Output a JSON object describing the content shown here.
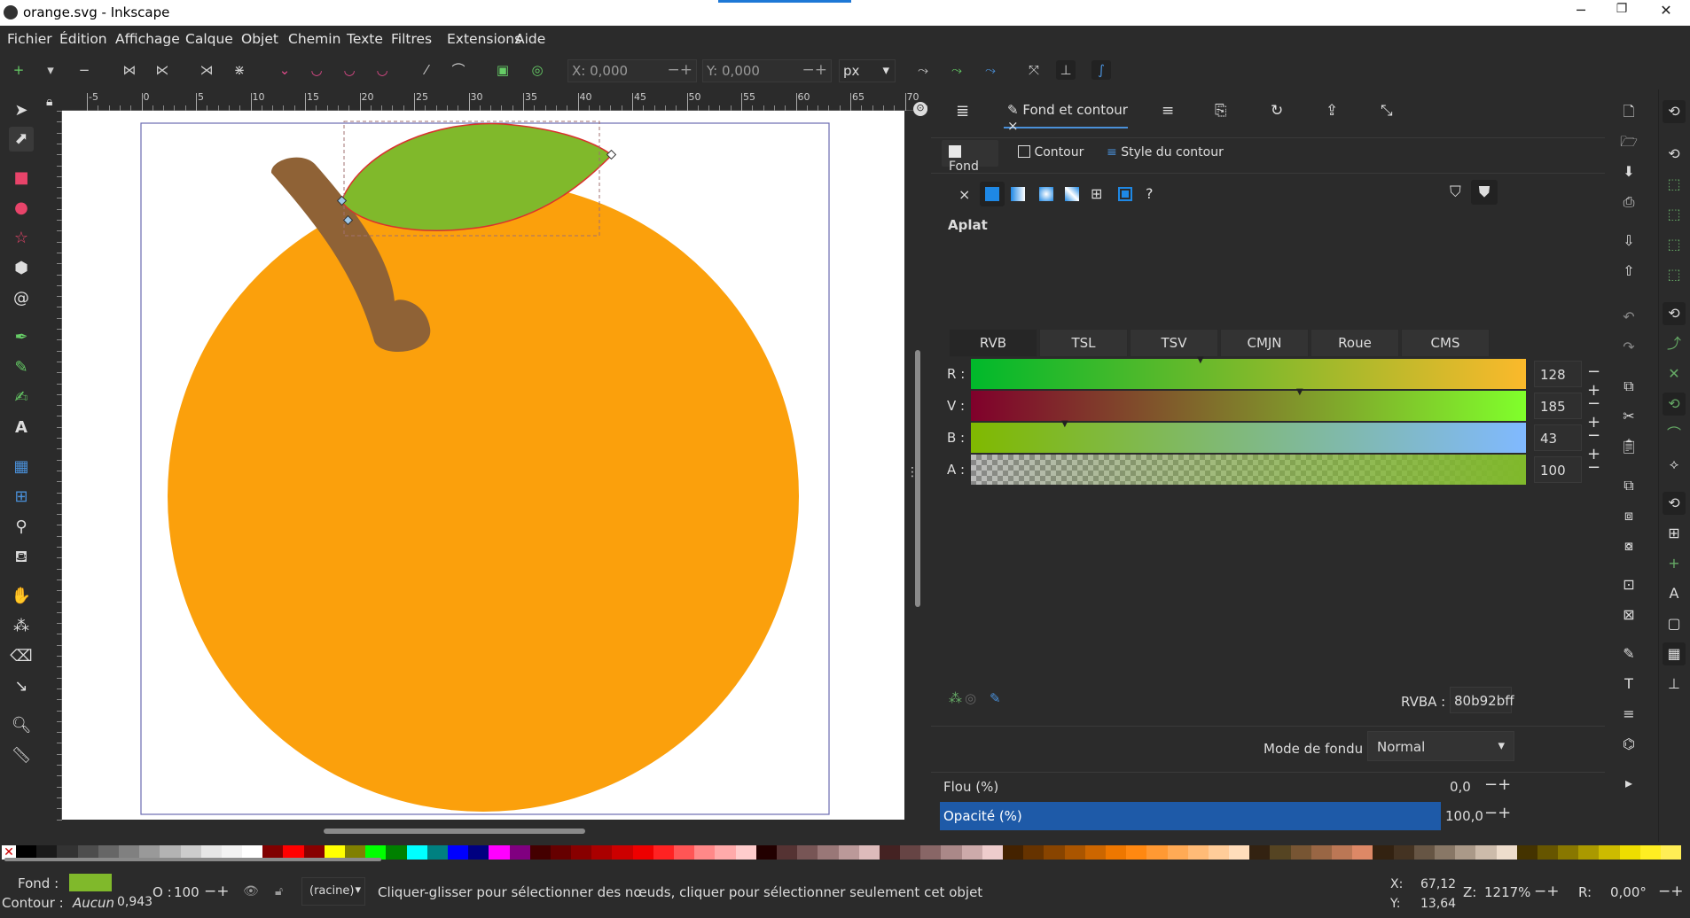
{
  "window": {
    "title": "orange.svg - Inkscape",
    "minimize": "─",
    "maximize": "❐",
    "close": "✕"
  },
  "menu": [
    "Fichier",
    "Édition",
    "Affichage",
    "Calque",
    "Objet",
    "Chemin",
    "Texte",
    "Filtres",
    "Extensions",
    "Aide"
  ],
  "toolbar": {
    "x_label": "X:",
    "x_value": "0,000",
    "y_label": "Y:",
    "y_value": "0,000",
    "unit": "px"
  },
  "ruler_labels": [
    "-5",
    "0",
    "5",
    "10",
    "15",
    "20",
    "25",
    "30",
    "35",
    "40",
    "45",
    "50",
    "55",
    "60",
    "65",
    "70"
  ],
  "dock": {
    "tab_title": "Fond et contour",
    "subtabs": {
      "fill": "Fond",
      "stroke": "Contour",
      "stroke_style": "Style du contour"
    },
    "paint_label": "Aplat",
    "color_modes": [
      "RVB",
      "TSL",
      "TSV",
      "CMJN",
      "Roue",
      "CMS"
    ],
    "sliders": [
      {
        "label": "R :",
        "value": "128"
      },
      {
        "label": "V :",
        "value": "185"
      },
      {
        "label": "B :",
        "value": "43"
      },
      {
        "label": "A :",
        "value": "100"
      }
    ],
    "rgba_label": "RVBA :",
    "rgba_value": "80b92bff",
    "blend_label": "Mode de fondu :",
    "blend_value": "Normal",
    "blur_label": "Flou (%)",
    "blur_value": "0,0",
    "opacity_label": "Opacité (%)",
    "opacity_value": "100,0",
    "unknown_paint": "?",
    "no_paint": "×"
  },
  "status": {
    "fill_label": "Fond :",
    "stroke_label": "Contour :",
    "stroke_value": "Aucun",
    "stroke_width": "0,943",
    "opacity_label": "O :",
    "opacity_value": "100",
    "layer": "(racine)",
    "message": "Cliquer-glisser pour sélectionner des nœuds, cliquer pour sélectionner seulement cet objet",
    "x_label": "X:",
    "x_value": "67,12",
    "y_label": "Y:",
    "y_value": "13,64",
    "zoom_label": "Z:",
    "zoom_value": "1217%",
    "rot_label": "R:",
    "rot_value": "0,00°"
  },
  "colors": {
    "orange": "#fba00c",
    "leaf": "#80b92b",
    "stem": "#8f6236",
    "accent": "#1e5aa8"
  }
}
